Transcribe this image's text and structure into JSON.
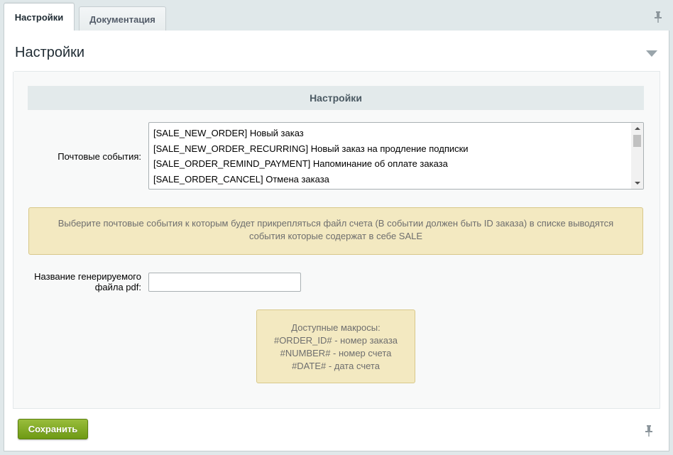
{
  "tabs": [
    {
      "label": "Настройки",
      "active": true
    },
    {
      "label": "Документация",
      "active": false
    }
  ],
  "section": {
    "title": "Настройки",
    "subheading": "Настройки"
  },
  "mail_events": {
    "label": "Почтовые события:",
    "options": [
      "[SALE_NEW_ORDER] Новый заказ",
      "[SALE_NEW_ORDER_RECURRING] Новый заказ на продление подписки",
      "[SALE_ORDER_REMIND_PAYMENT] Напоминание об оплате заказа",
      "[SALE_ORDER_CANCEL] Отмена заказа"
    ]
  },
  "hint": {
    "text": "Выберите почтовые события к которым будет прикрепляться файл счета (В событии должен быть ID заказа) в списке выводятся события которые содержат в себе SALE"
  },
  "pdf_name": {
    "label": "Название генерируемого файла pdf:",
    "value": "",
    "placeholder": ""
  },
  "macros": {
    "lines": [
      "Доступные макросы:",
      "#ORDER_ID# - номер заказа",
      "#NUMBER# - номер счета",
      "#DATE# - дата счета"
    ]
  },
  "footer": {
    "save_label": "Сохранить"
  },
  "icons": {
    "pin": "pin-icon",
    "collapse": "collapse-arrow-icon"
  },
  "colors": {
    "save_button": "#7aa51c",
    "hint_background": "#f3e9c1"
  }
}
